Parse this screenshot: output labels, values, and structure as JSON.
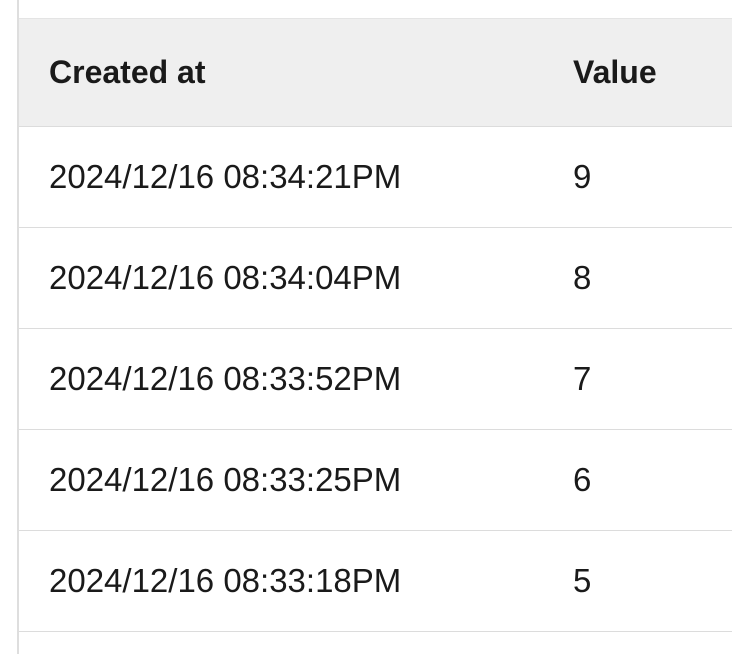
{
  "table": {
    "columns": [
      "Created at",
      "Value"
    ],
    "rows": [
      {
        "created_at": "2024/12/16 08:34:21PM",
        "value": "9"
      },
      {
        "created_at": "2024/12/16 08:34:04PM",
        "value": "8"
      },
      {
        "created_at": "2024/12/16 08:33:52PM",
        "value": "7"
      },
      {
        "created_at": "2024/12/16 08:33:25PM",
        "value": "6"
      },
      {
        "created_at": "2024/12/16 08:33:18PM",
        "value": "5"
      }
    ]
  }
}
